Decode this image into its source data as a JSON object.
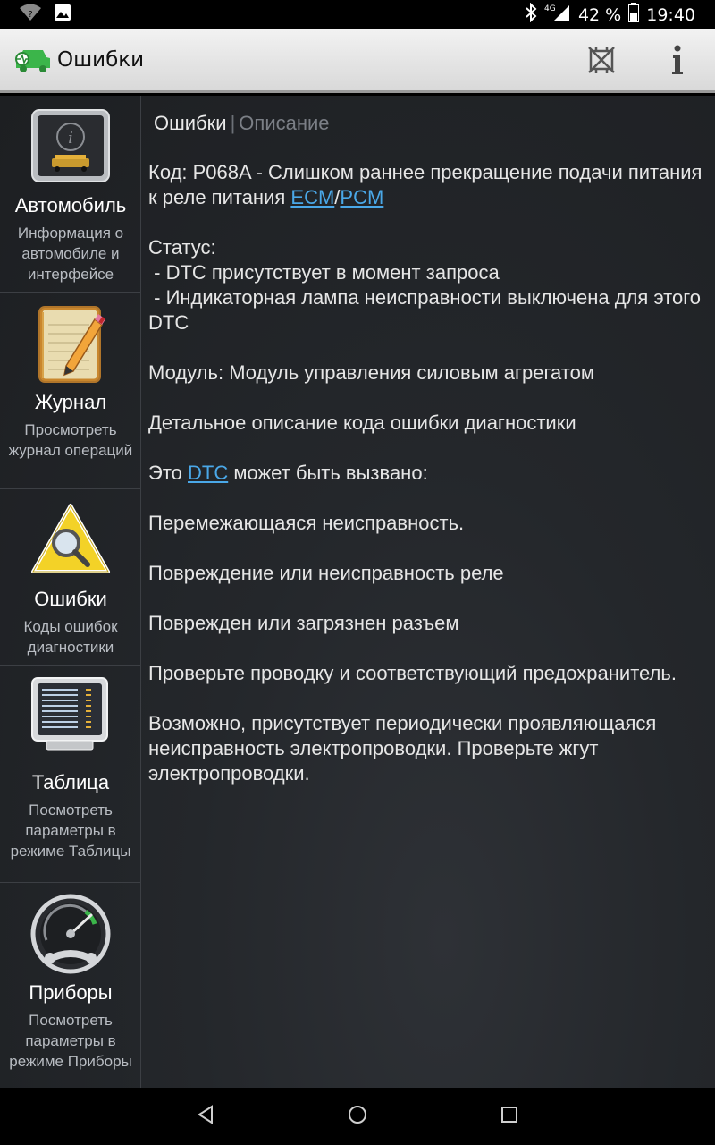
{
  "status_bar": {
    "battery": "42 %",
    "time": "19:40",
    "network": "4G"
  },
  "action_bar": {
    "title": "Ошибки"
  },
  "sidebar": {
    "items": [
      {
        "label": "Автомобиль",
        "desc": "Информация о автомобиле и интерфейсе",
        "icon": "car-info-icon"
      },
      {
        "label": "Журнал",
        "desc": "Просмотреть журнал операций",
        "icon": "notepad-icon"
      },
      {
        "label": "Ошибки",
        "desc": "Коды ошибок диагностики",
        "icon": "warning-magnifier-icon"
      },
      {
        "label": "Таблица",
        "desc": "Посмотреть параметры в режиме Таблицы",
        "icon": "monitor-table-icon"
      },
      {
        "label": "Приборы",
        "desc": "Посмотреть параметры в режиме Приборы",
        "icon": "gauge-icon"
      }
    ]
  },
  "tabs": {
    "active": "Ошибки",
    "separator": "|",
    "inactive": "Описание"
  },
  "description": {
    "code_prefix": "Код: P068A - Слишком раннее прекращение подачи питания к реле питания ",
    "link_ecm": "ECM",
    "slash": "/",
    "link_pcm": "PCM",
    "status_title": "Статус:",
    "status_1": " - DTC присутствует в момент запроса",
    "status_2": " - Индикаторная лампа неисправности выключена для этого DTC",
    "module": "Модуль: Модуль управления силовым агрегатом",
    "detail_title": "Детальное описание кода ошибки диагностики",
    "cause_prefix": "Это ",
    "link_dtc": "DTC",
    "cause_suffix": " может быть вызвано:",
    "cause_1": "Перемежающаяся неисправность.",
    "cause_2": "Повреждение или неисправность реле",
    "cause_3": "Поврежден или загрязнен разъем",
    "advice_1": "Проверьте проводку и соответствующий предохранитель.",
    "advice_2": "Возможно, присутствует периодически проявляющаяся неисправность электропроводки. Проверьте жгут электропроводки."
  },
  "colors": {
    "link": "#4aa8e8",
    "accent_green": "#3bb54a"
  }
}
